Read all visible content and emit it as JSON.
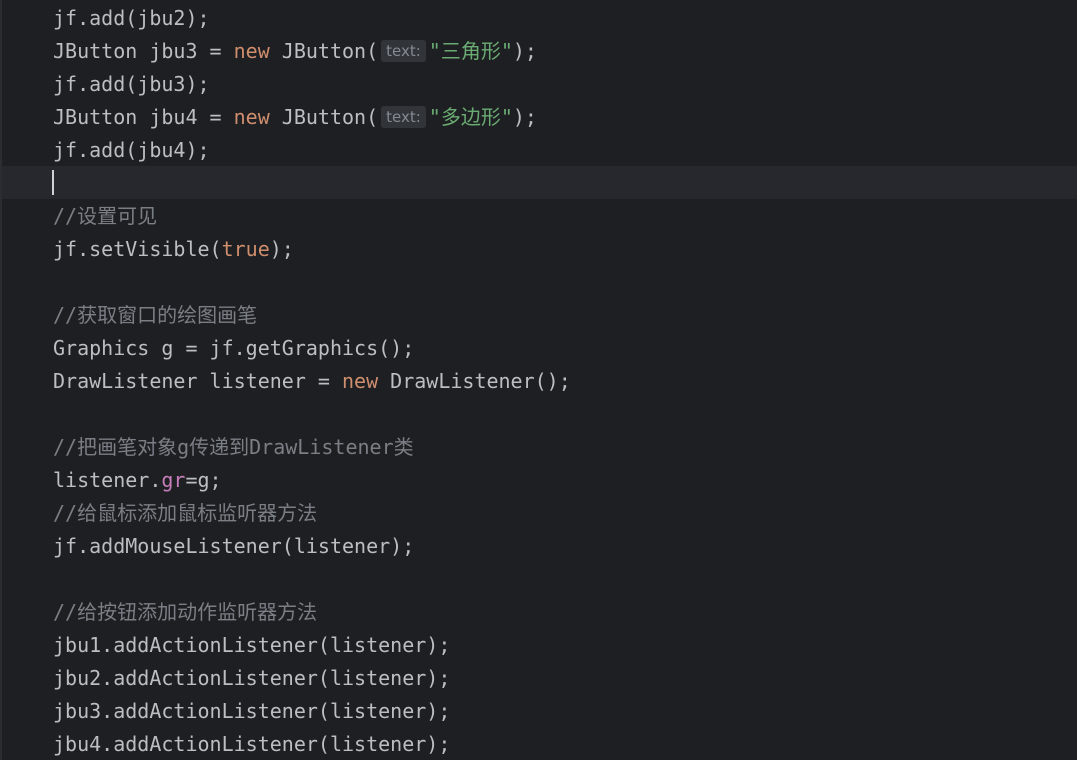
{
  "lines": [
    {
      "segments": [
        {
          "text": "jf.add(jbu2);"
        }
      ]
    },
    {
      "segments": [
        {
          "text": "JButton jbu3 = "
        },
        {
          "text": "new",
          "cls": "kw"
        },
        {
          "text": " JButton("
        },
        {
          "text": "text:",
          "cls": "hint"
        },
        {
          "text": "\"三角形\"",
          "cls": "str"
        },
        {
          "text": ");"
        }
      ]
    },
    {
      "segments": [
        {
          "text": "jf.add(jbu3);"
        }
      ]
    },
    {
      "segments": [
        {
          "text": "JButton jbu4 = "
        },
        {
          "text": "new",
          "cls": "kw"
        },
        {
          "text": " JButton("
        },
        {
          "text": "text:",
          "cls": "hint"
        },
        {
          "text": "\"多边形\"",
          "cls": "str"
        },
        {
          "text": ");"
        }
      ]
    },
    {
      "segments": [
        {
          "text": "jf.add(jbu4);"
        }
      ]
    },
    {
      "segments": []
    },
    {
      "segments": [
        {
          "text": "//设置可见",
          "cls": "cmt"
        }
      ]
    },
    {
      "segments": [
        {
          "text": "jf.setVisible("
        },
        {
          "text": "true",
          "cls": "kw"
        },
        {
          "text": ");"
        }
      ]
    },
    {
      "segments": []
    },
    {
      "segments": [
        {
          "text": "//获取窗口的绘图画笔",
          "cls": "cmt"
        }
      ]
    },
    {
      "segments": [
        {
          "text": "Graphics g = jf.getGraphics();"
        }
      ]
    },
    {
      "segments": [
        {
          "text": "DrawListener listener = "
        },
        {
          "text": "new",
          "cls": "kw"
        },
        {
          "text": " DrawListener();"
        }
      ]
    },
    {
      "segments": []
    },
    {
      "segments": [
        {
          "text": "//把画笔对象g传递到DrawListener类",
          "cls": "cmt"
        }
      ]
    },
    {
      "segments": [
        {
          "text": "listener."
        },
        {
          "text": "gr",
          "cls": "field"
        },
        {
          "text": "=g;"
        }
      ]
    },
    {
      "segments": [
        {
          "text": "//给鼠标添加鼠标监听器方法",
          "cls": "cmt"
        }
      ]
    },
    {
      "segments": [
        {
          "text": "jf.addMouseListener(listener);"
        }
      ]
    },
    {
      "segments": []
    },
    {
      "segments": [
        {
          "text": "//给按钮添加动作监听器方法",
          "cls": "cmt"
        }
      ]
    },
    {
      "segments": [
        {
          "text": "jbu1.addActionListener(listener);"
        }
      ]
    },
    {
      "segments": [
        {
          "text": "jbu2.addActionListener(listener);"
        }
      ]
    },
    {
      "segments": [
        {
          "text": "jbu3.addActionListener(listener);"
        }
      ]
    },
    {
      "segments": [
        {
          "text": "jbu4.addActionListener(listener);"
        }
      ]
    }
  ],
  "colors": {
    "background": "#1e1f22",
    "current_line": "#26282e",
    "keyword": "#cf8e6d",
    "string": "#6aab73",
    "comment": "#7a7e85",
    "field": "#c77dbb",
    "default_text": "#bcbec4"
  }
}
